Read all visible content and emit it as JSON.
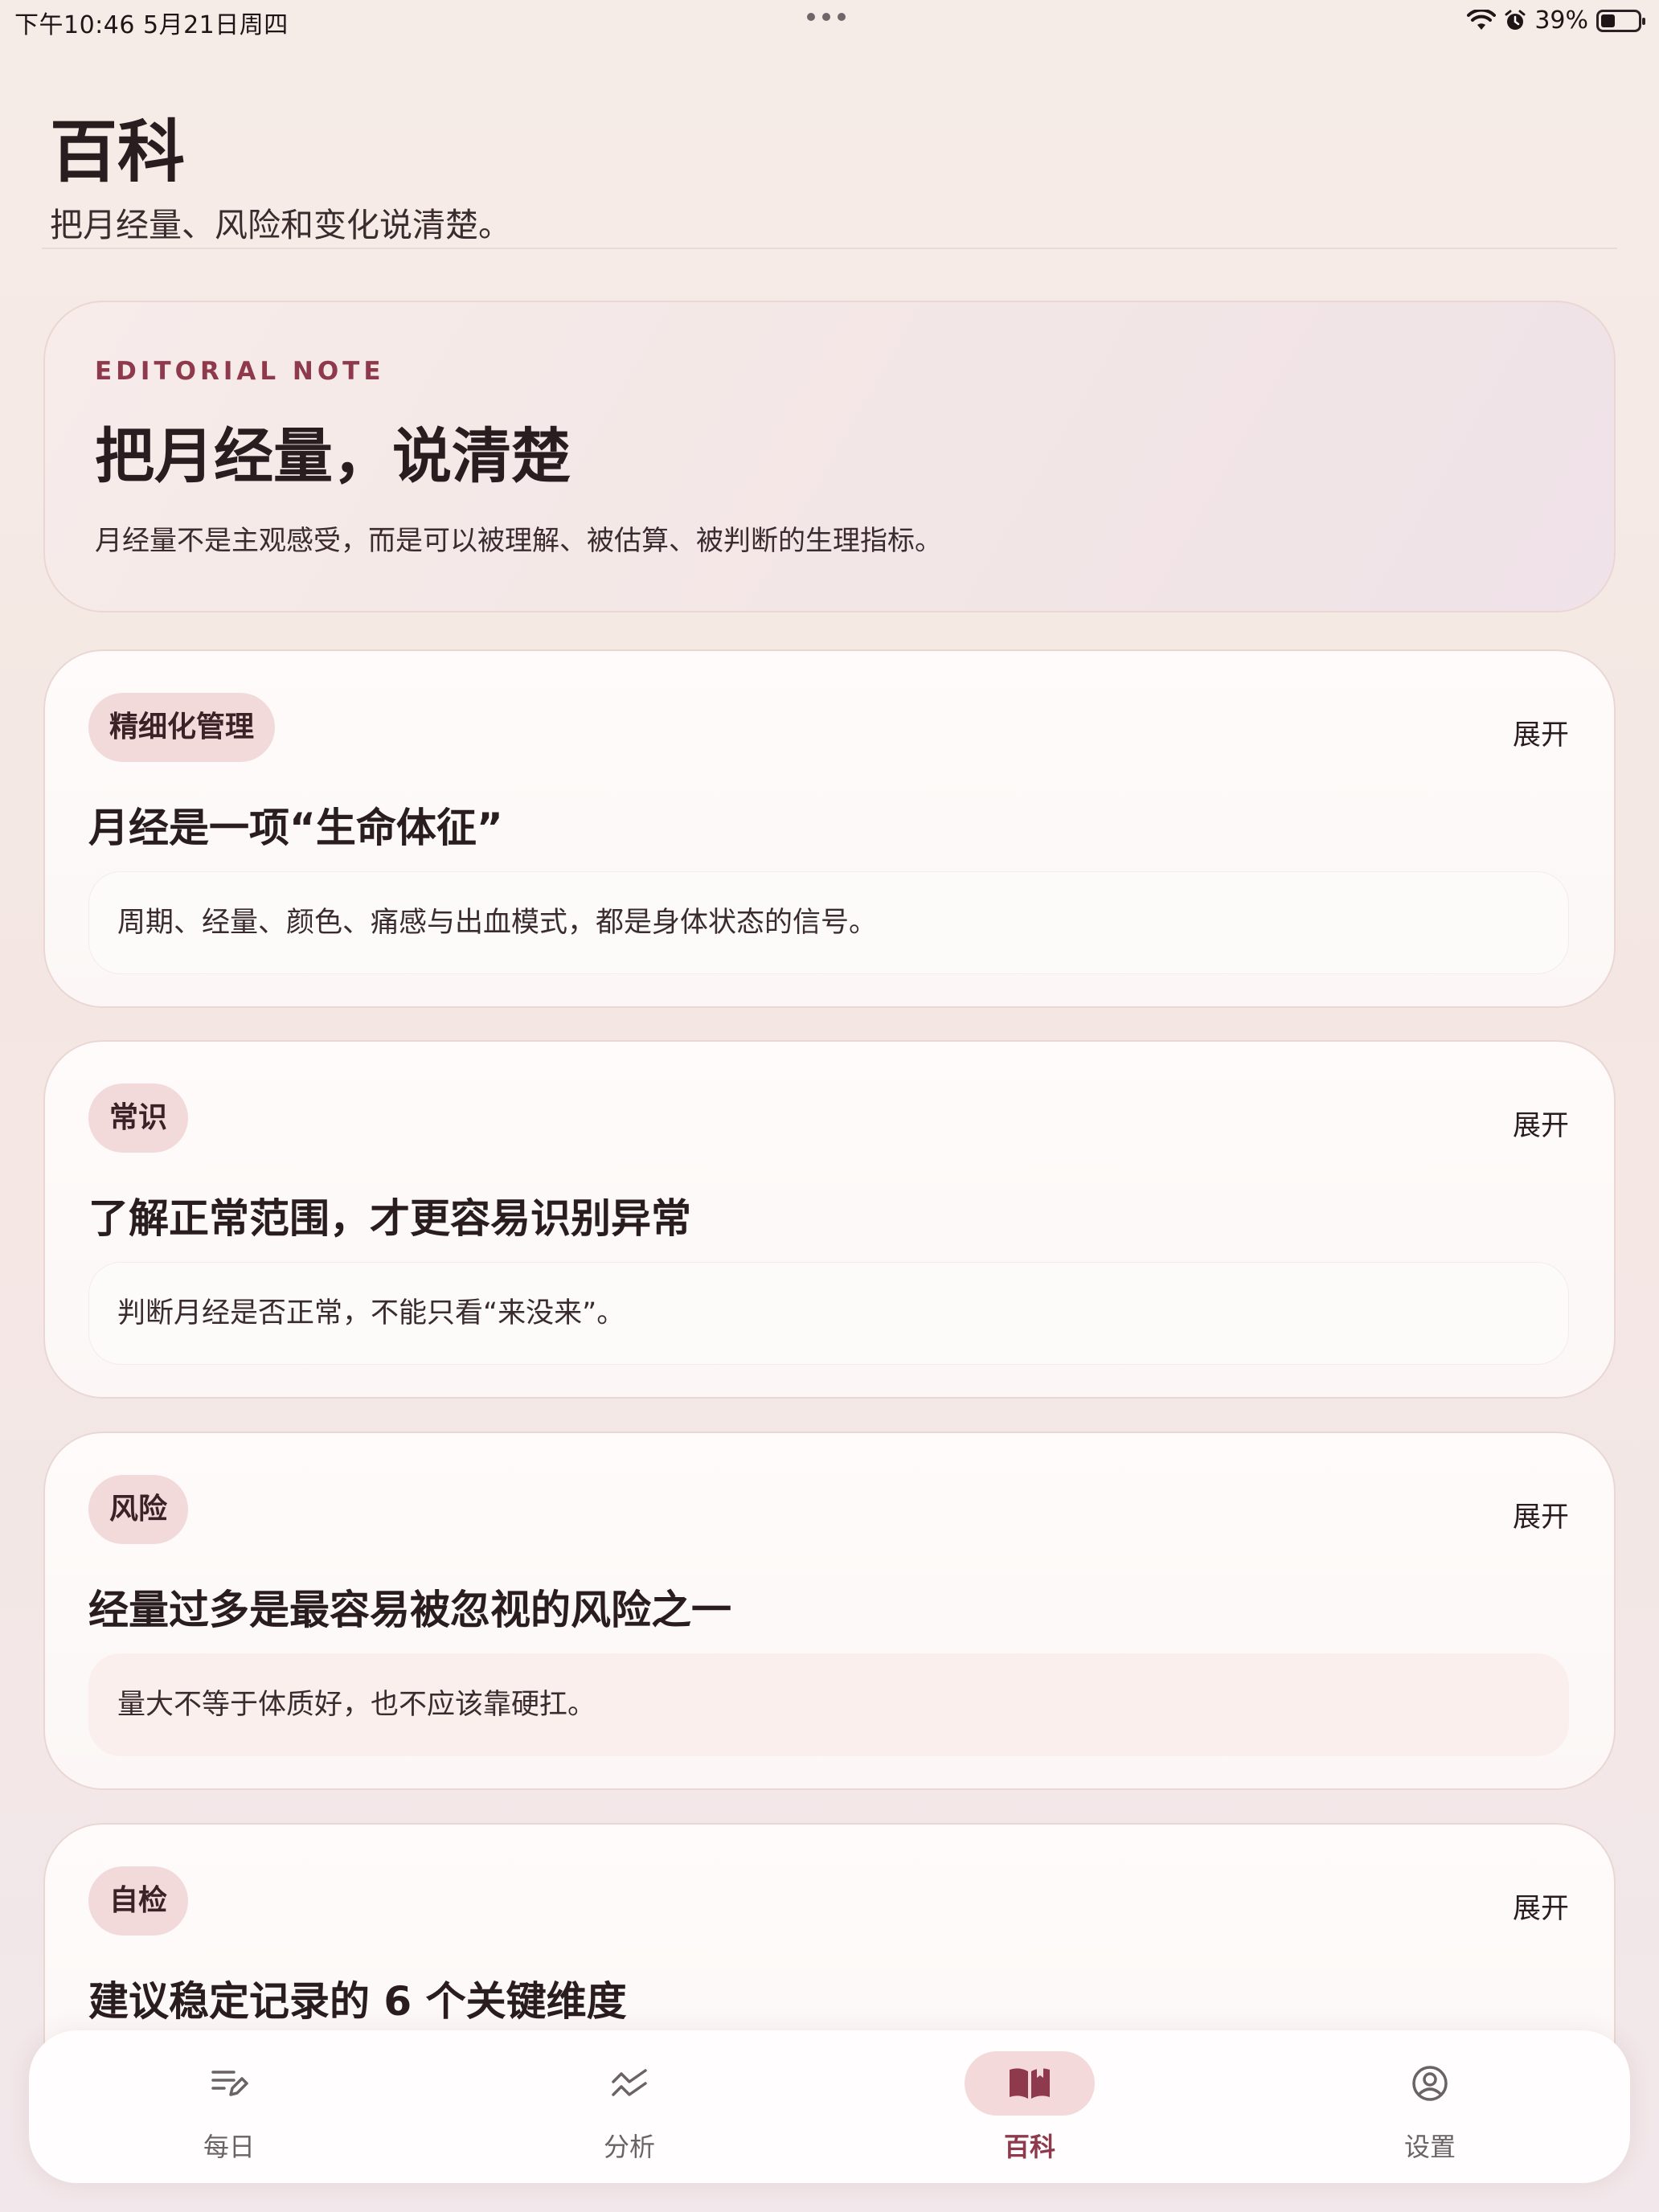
{
  "status_bar": {
    "time": "下午10:46   5月21日周四",
    "battery": "39%",
    "battery_level": 0.39
  },
  "header": {
    "title": "百科",
    "subtitle": "把月经量、风险和变化说清楚。"
  },
  "editorial": {
    "eyebrow": "EDITORIAL NOTE",
    "title": "把月经量，说清楚",
    "description": "月经量不是主观感受，而是可以被理解、被估算、被判断的生理指标。"
  },
  "cards": [
    {
      "tag": "精细化管理",
      "expand": "展开",
      "title": "月经是一项“生命体征”",
      "summary": "周期、经量、颜色、痛感与出血模式，都是身体状态的信号。"
    },
    {
      "tag": "常识",
      "expand": "展开",
      "title": "了解正常范围，才更容易识别异常",
      "summary": "判断月经是否正常，不能只看“来没来”。"
    },
    {
      "tag": "风险",
      "expand": "展开",
      "title": "经量过多是最容易被忽视的风险之一",
      "summary": "量大不等于体质好，也不应该靠硬扛。"
    },
    {
      "tag": "自检",
      "expand": "展开",
      "title": "建议稳定记录的 6 个关键维度",
      "summary": ""
    }
  ],
  "tabs": [
    {
      "label": "每日",
      "icon": "edit-list-icon"
    },
    {
      "label": "分析",
      "icon": "trend-icon"
    },
    {
      "label": "百科",
      "icon": "book-icon",
      "active": true
    },
    {
      "label": "设置",
      "icon": "user-circle-icon"
    }
  ],
  "colors": {
    "accent": "#8e3a4c",
    "tag_bg": "#f2dadb",
    "active_tab_bg": "#f3d9da"
  }
}
